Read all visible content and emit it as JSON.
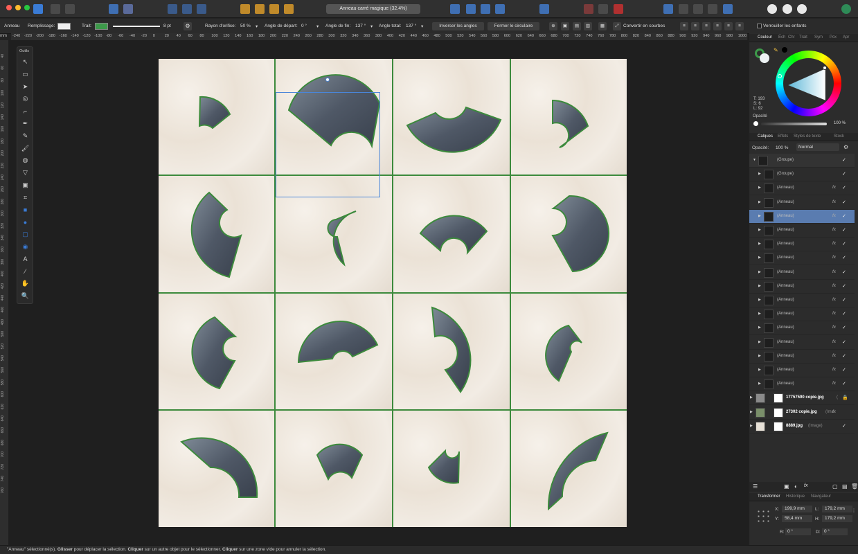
{
  "app": {
    "doc_title": "Anneau carré magique (32.4%)",
    "unit": "mm"
  },
  "context_toolbar": {
    "shape_label": "Anneau",
    "fill_label": "Remplissage:",
    "stroke_label": "Trait:",
    "stroke_width": "8 pt",
    "radius_label": "Rayon d'orifice:",
    "radius_value": "50 %",
    "start_label": "Angle de départ:",
    "start_value": "0 °",
    "end_label": "Angle de fin:",
    "end_value": "137 °",
    "total_label": "Angle total:",
    "total_value": "137 °",
    "invert_btn": "Inverser les angles",
    "close_btn": "Fermer le circulaire",
    "convert_btn": "Convertir en courbes",
    "lock_label": "Verrouiller les enfants",
    "fill_color": "#f0f0f0",
    "stroke_color": "#3d9a4a"
  },
  "ruler_top": [
    "-240",
    "-220",
    "-200",
    "-180",
    "-160",
    "-140",
    "-120",
    "-100",
    "-80",
    "-60",
    "-40",
    "-20",
    "0",
    "20",
    "40",
    "60",
    "80",
    "100",
    "120",
    "140",
    "160",
    "180",
    "200",
    "220",
    "240",
    "260",
    "280",
    "300",
    "320",
    "340",
    "360",
    "380",
    "400",
    "420",
    "440",
    "460",
    "480",
    "500",
    "520",
    "540",
    "560",
    "580",
    "600",
    "620",
    "640",
    "660",
    "680",
    "700",
    "720",
    "740",
    "760",
    "780",
    "800",
    "820",
    "840",
    "860",
    "880",
    "900",
    "920",
    "940",
    "960",
    "980",
    "1000"
  ],
  "ruler_left": [
    "40",
    "60",
    "80",
    "100",
    "120",
    "140",
    "160",
    "180",
    "200",
    "220",
    "240",
    "260",
    "280",
    "300",
    "320",
    "340",
    "360",
    "380",
    "400",
    "420",
    "440",
    "460",
    "480",
    "500",
    "520",
    "540",
    "560",
    "580",
    "600",
    "620",
    "640",
    "660",
    "680",
    "700",
    "720",
    "740",
    "760"
  ],
  "tools": {
    "title": "Outils",
    "items": [
      "move-icon",
      "artboard-icon",
      "node-icon",
      "contour-icon",
      "corner-icon",
      "pen-icon",
      "pencil-icon",
      "brush-icon",
      "fill-icon",
      "transparency-icon",
      "image-icon",
      "crop-icon",
      "rectangle-icon",
      "ellipse-icon",
      "rounded-rect-icon",
      "donut-icon",
      "text-icon",
      "eyedropper-icon",
      "hand-icon",
      "zoom-icon"
    ]
  },
  "color_panel": {
    "tabs": [
      "Couleur",
      "Éch",
      "Chr",
      "Trait",
      "Sym",
      "Pcx",
      "Apr"
    ],
    "h": "T: 193",
    "s": "S: 6",
    "l": "L: 92",
    "opacity_label": "Opacité",
    "opacity_value": "100 %"
  },
  "layers_panel": {
    "tabs": [
      "Calques",
      "Effets",
      "Styles de texte",
      "Stock"
    ],
    "opacity_label": "Opacité:",
    "opacity_value": "100 %",
    "blend_mode": "Normal",
    "rows": [
      {
        "name": "(Groupe)",
        "fx": "",
        "check": "✓",
        "arrow": "▼"
      },
      {
        "name": "(Groupe)",
        "fx": "",
        "check": "✓",
        "arrow": "▶"
      },
      {
        "name": "(Anneau)",
        "fx": "fx",
        "check": "✓",
        "arrow": "▶"
      },
      {
        "name": "(Anneau)",
        "fx": "fx",
        "check": "✓",
        "arrow": "▶"
      },
      {
        "name": "(Anneau)",
        "fx": "fx",
        "check": "✓",
        "arrow": "▶"
      },
      {
        "name": "(Anneau)",
        "fx": "fx",
        "check": "✓",
        "arrow": "▶"
      },
      {
        "name": "(Anneau)",
        "fx": "fx",
        "check": "✓",
        "arrow": "▶"
      },
      {
        "name": "(Anneau)",
        "fx": "fx",
        "check": "✓",
        "arrow": "▶"
      },
      {
        "name": "(Anneau)",
        "fx": "fx",
        "check": "✓",
        "arrow": "▶"
      },
      {
        "name": "(Anneau)",
        "fx": "fx",
        "check": "✓",
        "arrow": "▶"
      },
      {
        "name": "(Anneau)",
        "fx": "fx",
        "check": "✓",
        "arrow": "▶"
      },
      {
        "name": "(Anneau)",
        "fx": "fx",
        "check": "✓",
        "arrow": "▶"
      },
      {
        "name": "(Anneau)",
        "fx": "fx",
        "check": "✓",
        "arrow": "▶"
      },
      {
        "name": "(Anneau)",
        "fx": "fx",
        "check": "✓",
        "arrow": "▶"
      },
      {
        "name": "(Anneau)",
        "fx": "fx",
        "check": "✓",
        "arrow": "▶"
      },
      {
        "name": "(Anneau)",
        "fx": "fx",
        "check": "✓",
        "arrow": "▶"
      },
      {
        "name": "(Anneau)",
        "fx": "fx",
        "check": "✓",
        "arrow": "▶"
      },
      {
        "name": "17757590 copie.jpg",
        "fx": "",
        "check": "🔒",
        "arrow": "▶",
        "sub": "("
      },
      {
        "name": "27302 copie.jpg",
        "fx": "fx",
        "check": "",
        "arrow": "▶",
        "sub": "(Ima"
      },
      {
        "name": "8889.jpg",
        "fx": "",
        "check": "✓",
        "arrow": "▶",
        "sub": "(Image)"
      }
    ]
  },
  "transform_panel": {
    "tabs": [
      "Transformer",
      "Historique",
      "Navigateur"
    ],
    "x": "199,9 mm",
    "y": "58,4 mm",
    "w": "179,2 mm",
    "h": "179,2 mm",
    "r": "0 °",
    "s": "0 °"
  },
  "status": {
    "pre": "\"Anneau\" sélectionné(s). ",
    "b1": "Glisser",
    "t1": " pour déplacer la sélection. ",
    "b2": "Cliquer",
    "t2": " sur un autre objet pour le sélectionner. ",
    "b3": "Cliquer",
    "t3": " sur une zone vide pour annuler la sélection."
  }
}
